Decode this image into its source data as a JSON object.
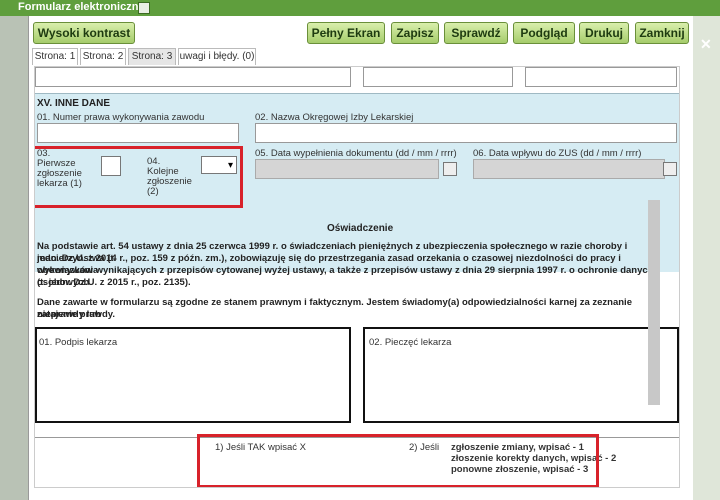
{
  "window": {
    "title": "Formularz elektroniczny"
  },
  "toolbar": {
    "high_contrast": "Wysoki kontrast",
    "full_screen": "Pełny Ekran",
    "save": "Zapisz",
    "check": "Sprawdź",
    "preview": "Podgląd",
    "print": "Drukuj",
    "close": "Zamknij"
  },
  "tabs": [
    "Strona: 1",
    "Strona: 2",
    "Strona: 3",
    "uwagi i błędy. (0)"
  ],
  "section": {
    "title": "XV. INNE DANE",
    "field01": "01. Numer prawa wykonywania zawodu",
    "field02": "02. Nazwa Okręgowej Izby Lekarskiej",
    "field03_num": "03.",
    "field03_l1": "Pierwsze",
    "field03_l2": "zgłoszenie",
    "field03_l3": "lekarza (1)",
    "field04_num": "04.",
    "field04_l1": "Kolejne",
    "field04_l2": "zgłoszenie",
    "field04_l3": "(2)",
    "field05": "05. Data wypełnienia dokumentu (dd / mm / rrrr)",
    "field06": "06. Data wpływu do ZUS (dd / mm / rrrr)"
  },
  "statement": {
    "title": "Oświadczenie",
    "p1_l1": "Na podstawie art. 54 ustawy z dnia 25 czerwca 1999 r. o świadczeniach pieniężnych z ubezpieczenia społecznego w razie choroby i macierzyństwa (t.",
    "p1_l2": "jedn. Dz.U. z 2014 r., poz. 159 z późn. zm.), zobowiązuję się do przestrzegania zasad orzekania o czasowej niezdolności do pracy i wykonywania",
    "p1_l3": "obowiązków wynikających z przepisów cytowanej wyżej ustawy, a także z przepisów ustawy z dnia 29 sierpnia 1997 r. o ochronie danych osobowych",
    "p1_l4": "(t. jedn. Dz.U. z 2015 r., poz. 2135).",
    "p2_l1": "Dane zawarte w formularzu są zgodne ze stanem prawnym i faktycznym. Jestem świadomy(a) odpowiedzialności karnej za zeznanie nieprawdy lub",
    "p2_l2": "zatajenie prawdy."
  },
  "signatures": {
    "sig01": "01. Podpis lekarza",
    "sig02": "02. Pieczęć lekarza"
  },
  "footer": {
    "note1": "1) Jeśli TAK wpisać X",
    "note2": "2) Jeśli",
    "note2_l1": "zgłoszenie zmiany, wpisać - 1",
    "note2_l2": "złoszenie korekty danych, wpisać - 2",
    "note2_l3": "ponowne złoszenie, wpisać - 3"
  },
  "colors": {
    "titlebar": "#5f9e3d",
    "section_bg": "#d6ecf3",
    "highlight": "#d8222a"
  }
}
